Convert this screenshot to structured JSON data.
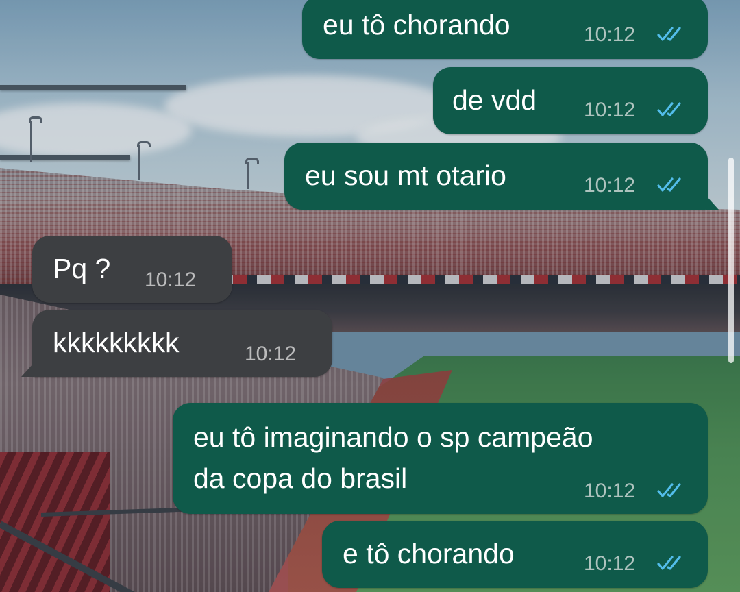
{
  "wallpaper": {
    "subject": "stadium-photo"
  },
  "colors": {
    "outgoing_bubble": "#0f5a4a",
    "incoming_bubble": "#3d3f42",
    "read_receipt": "#53bdeb",
    "timestamp": "#dcdcdc"
  },
  "messages": [
    {
      "direction": "outgoing",
      "text": "eu tô chorando",
      "time": "10:12",
      "status": "read"
    },
    {
      "direction": "outgoing",
      "text": "de vdd",
      "time": "10:12",
      "status": "read"
    },
    {
      "direction": "outgoing",
      "text": "eu sou mt otario",
      "time": "10:12",
      "status": "read"
    },
    {
      "direction": "incoming",
      "text": "Pq ?",
      "time": "10:12"
    },
    {
      "direction": "incoming",
      "text": "kkkkkkkkk",
      "time": "10:12"
    },
    {
      "direction": "outgoing",
      "text": "eu tô imaginando o sp campeão\nda copa do brasil",
      "time": "10:12",
      "status": "read"
    },
    {
      "direction": "outgoing",
      "text": "e tô chorando",
      "time": "10:12",
      "status": "read"
    }
  ],
  "icons": {
    "read_receipt": "double-check-icon"
  }
}
